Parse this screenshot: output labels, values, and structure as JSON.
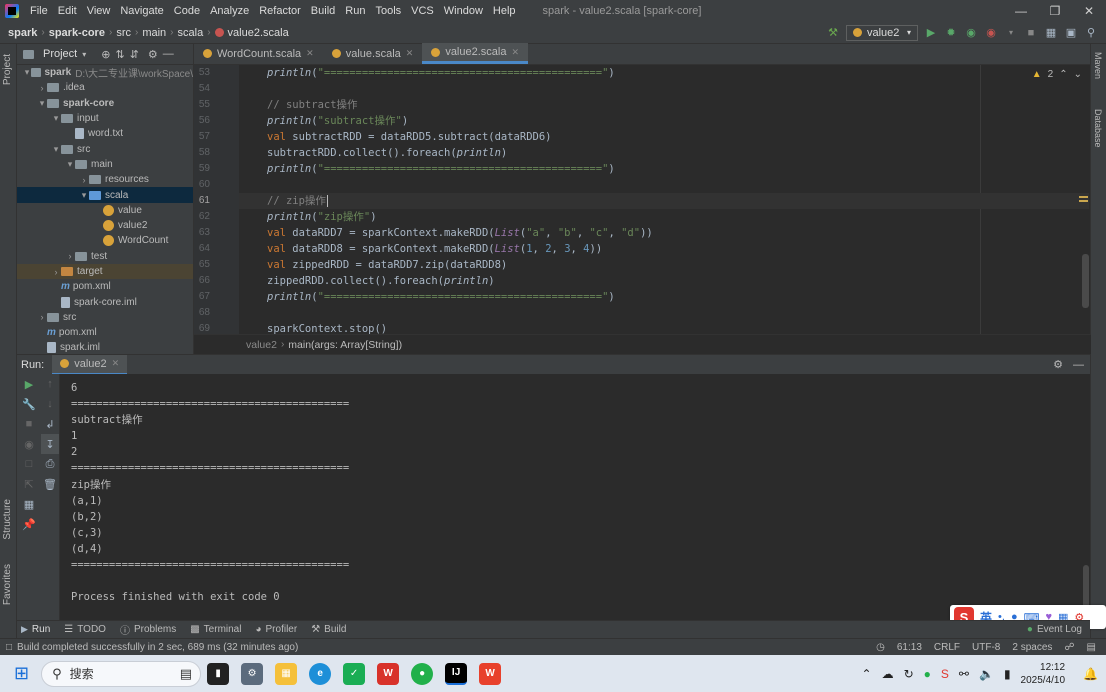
{
  "menubar": {
    "items": [
      "File",
      "Edit",
      "View",
      "Navigate",
      "Code",
      "Analyze",
      "Refactor",
      "Build",
      "Run",
      "Tools",
      "VCS",
      "Window",
      "Help"
    ],
    "window_title": "spark - value2.scala [spark-core]"
  },
  "navbar": {
    "breadcrumbs": [
      "spark",
      "spark-core",
      "src",
      "main",
      "scala",
      "value2.scala"
    ],
    "run_config": "value2"
  },
  "left_strip": {
    "project_tab": "Project",
    "structure_tab": "Structure",
    "favorites_tab": "Favorites"
  },
  "right_strip": {
    "maven_tab": "Maven",
    "database_tab": "Database"
  },
  "project": {
    "header_label": "Project",
    "tree": [
      {
        "label": "spark",
        "hint": "D:\\大二专业课\\workSpace\\",
        "indent": 0,
        "arrow": "▾",
        "icon": "folder-grey"
      },
      {
        "label": ".idea",
        "indent": 1,
        "arrow": "›",
        "icon": "folder-grey"
      },
      {
        "label": "spark-core",
        "indent": 1,
        "arrow": "▾",
        "icon": "folder-grey"
      },
      {
        "label": "input",
        "indent": 2,
        "arrow": "▾",
        "icon": "folder-grey"
      },
      {
        "label": "word.txt",
        "indent": 3,
        "arrow": "",
        "icon": "file"
      },
      {
        "label": "src",
        "indent": 2,
        "arrow": "▾",
        "icon": "folder-grey"
      },
      {
        "label": "main",
        "indent": 3,
        "arrow": "▾",
        "icon": "folder-grey"
      },
      {
        "label": "resources",
        "indent": 4,
        "arrow": "›",
        "icon": "folder-grey"
      },
      {
        "label": "scala",
        "indent": 4,
        "arrow": "▾",
        "icon": "folder-blue",
        "selected": true
      },
      {
        "label": "value",
        "indent": 5,
        "arrow": "",
        "icon": "scala"
      },
      {
        "label": "value2",
        "indent": 5,
        "arrow": "",
        "icon": "scala"
      },
      {
        "label": "WordCount",
        "indent": 5,
        "arrow": "",
        "icon": "scala"
      },
      {
        "label": "test",
        "indent": 3,
        "arrow": "›",
        "icon": "folder-grey"
      },
      {
        "label": "target",
        "indent": 2,
        "arrow": "›",
        "icon": "folder-orange",
        "target": true
      },
      {
        "label": "pom.xml",
        "indent": 2,
        "arrow": "",
        "icon": "maven"
      },
      {
        "label": "spark-core.iml",
        "indent": 2,
        "arrow": "",
        "icon": "file"
      },
      {
        "label": "src",
        "indent": 1,
        "arrow": "›",
        "icon": "folder-grey"
      },
      {
        "label": "pom.xml",
        "indent": 1,
        "arrow": "",
        "icon": "maven"
      },
      {
        "label": "spark.iml",
        "indent": 1,
        "arrow": "",
        "icon": "file"
      }
    ]
  },
  "editor": {
    "tabs": [
      {
        "label": "WordCount.scala",
        "active": false
      },
      {
        "label": "value.scala",
        "active": false
      },
      {
        "label": "value2.scala",
        "active": true
      }
    ],
    "warnings": "2",
    "line_numbers": [
      "53",
      "54",
      "55",
      "56",
      "57",
      "58",
      "59",
      "60",
      "61",
      "62",
      "63",
      "64",
      "65",
      "66",
      "67",
      "68",
      "69"
    ],
    "current_line": "61",
    "breadcrumb": [
      "value2",
      "main(args: Array[String])"
    ]
  },
  "run_panel": {
    "label": "Run:",
    "tab": "value2",
    "console": [
      "6",
      "============================================",
      "subtract操作",
      "1",
      "2",
      "============================================",
      "zip操作",
      "(a,1)",
      "(b,2)",
      "(c,3)",
      "(d,4)",
      "============================================",
      "",
      "Process finished with exit code 0"
    ]
  },
  "bottom_tabs": [
    "Run",
    "TODO",
    "Problems",
    "Terminal",
    "Profiler",
    "Build",
    "Event Log"
  ],
  "status": {
    "message": "Build completed successfully in 2 sec, 689 ms (32 minutes ago)",
    "position": "61:13",
    "line_sep": "CRLF",
    "encoding": "UTF-8",
    "indent": "2 spaces"
  },
  "taskbar": {
    "search_placeholder": "搜索",
    "time": "12:12",
    "date": "2025/4/10"
  },
  "ime": {
    "label": "英"
  }
}
